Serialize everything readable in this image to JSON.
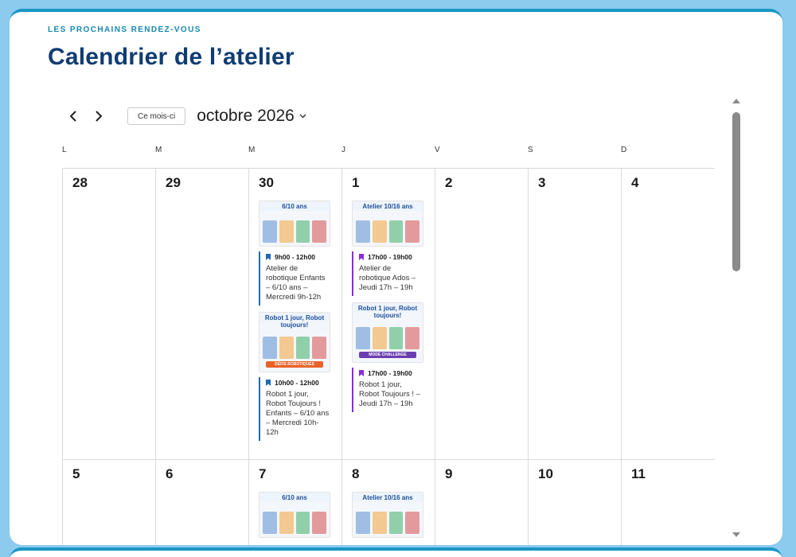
{
  "header": {
    "eyebrow": "LES PROCHAINS RENDEZ-VOUS",
    "title": "Calendrier de l’atelier"
  },
  "toolbar": {
    "prev_icon": "chevron-left-icon",
    "next_icon": "chevron-right-icon",
    "today_label": "Ce mois-ci",
    "month_label": "octobre 2026"
  },
  "weekdays": [
    "L",
    "M",
    "M",
    "J",
    "V",
    "S",
    "D"
  ],
  "weeks": [
    {
      "days": [
        {
          "num": "28"
        },
        {
          "num": "29"
        },
        {
          "num": "30",
          "events": [
            {
              "time": "9h00 - 12h00",
              "title": "Atelier de robotique Enfants – 6/10 ans – Mercredi 9h-12h",
              "color": "#1e6bb8",
              "thumb": "6/10 ans"
            },
            {
              "time": "10h00 - 12h00",
              "title": "Robot 1 jour, Robot Toujours ! Enfants – 6/10 ans – Mercredi 10h-12h",
              "color": "#1e6bb8",
              "thumb": "Robot 1 jour, Robot toujours!",
              "badge": "DÉFIS ROBOTIQUES"
            }
          ]
        },
        {
          "num": "1",
          "events": [
            {
              "time": "17h00 - 19h00",
              "title": "Atelier de robotique Ados – Jeudi 17h – 19h",
              "color": "#8a2be2",
              "thumb": "Atelier 10/16 ans"
            },
            {
              "time": "17h00 - 19h00",
              "title": "Robot 1 jour, Robot Toujours ! – Jeudi 17h – 19h",
              "color": "#8a2be2",
              "thumb": "Robot 1 jour, Robot toujours!",
              "badge": "MODE CHALLENGE"
            }
          ]
        },
        {
          "num": "2"
        },
        {
          "num": "3"
        },
        {
          "num": "4"
        }
      ]
    },
    {
      "days": [
        {
          "num": "5"
        },
        {
          "num": "6"
        },
        {
          "num": "7",
          "events": [
            {
              "thumb": "6/10 ans"
            }
          ]
        },
        {
          "num": "8",
          "events": [
            {
              "thumb": "Atelier 10/16 ans"
            }
          ]
        },
        {
          "num": "9"
        },
        {
          "num": "10"
        },
        {
          "num": "11"
        }
      ]
    }
  ],
  "colors": {
    "brand": "#0f3c72",
    "accent": "#1788ad",
    "frame": "#8ccaee",
    "event_blue": "#1e6bb8",
    "event_purple": "#8a2be2"
  }
}
